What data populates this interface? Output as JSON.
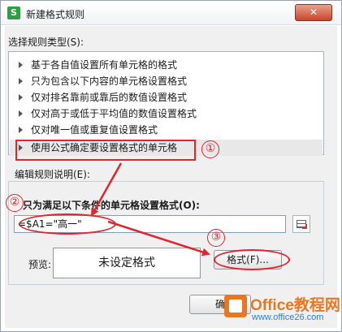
{
  "window": {
    "title": "新建格式规则",
    "app_icon_glyph": "S",
    "close_glyph": "✕"
  },
  "rule_type": {
    "label": "选择规则类型(S):",
    "items": [
      {
        "label": "基于各自值设置所有单元格的格式"
      },
      {
        "label": "只为包含以下内容的单元格设置格式"
      },
      {
        "label": "仅对排名靠前或靠后的数值设置格式"
      },
      {
        "label": "仅对高于或低于平均值的数值设置格式"
      },
      {
        "label": "仅对唯一值或重复值设置格式"
      },
      {
        "label": "使用公式确定要设置格式的单元格",
        "selected": true
      }
    ]
  },
  "edit_desc": {
    "label": "编辑规则说明(E):",
    "formula_label": "只为满足以下条件的单元格设置格式(O):",
    "formula_value": "=$A1=\"高一\""
  },
  "preview": {
    "label": "预览:",
    "text": "未设定格式",
    "format_button": "格式(F)..."
  },
  "footer": {
    "ok_button_visible": "确"
  },
  "annotations": {
    "marker_1": "①",
    "marker_2": "②",
    "marker_3": "③",
    "color": "#e0262e"
  },
  "watermark": {
    "title": "Office教程网",
    "url": "www.office26.com"
  }
}
